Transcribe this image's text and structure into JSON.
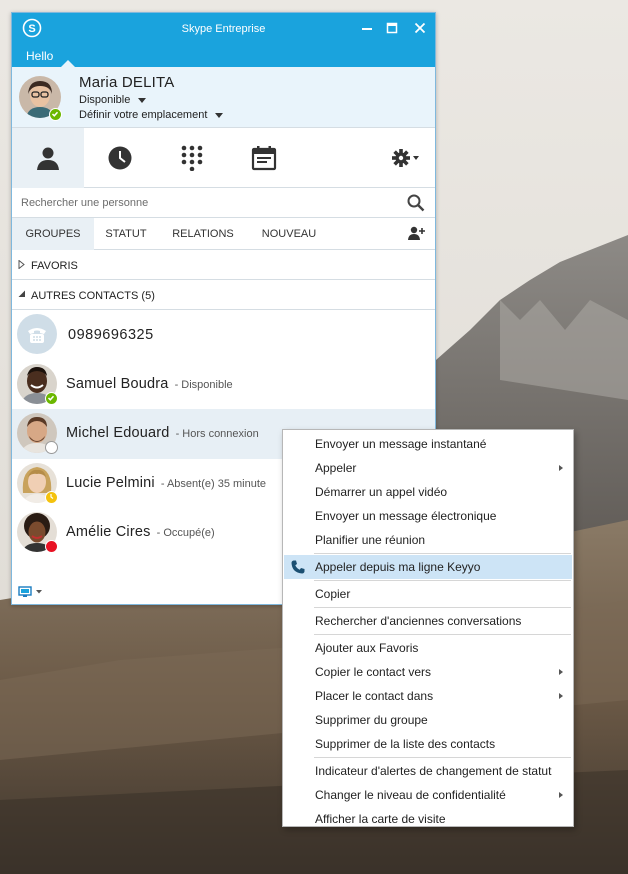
{
  "window": {
    "title": "Skype Entreprise",
    "hello": "Hello",
    "controls": {
      "minimize": "—",
      "maximize": "☐",
      "close": "✕"
    }
  },
  "profile": {
    "name": "Maria DELITA",
    "status": "Disponible",
    "location": "Définir votre emplacement",
    "presence_color": "#6bb700"
  },
  "main_tabs": [
    {
      "icon": "person-icon"
    },
    {
      "icon": "clock-icon"
    },
    {
      "icon": "dialpad-icon"
    },
    {
      "icon": "calendar-icon"
    },
    {
      "icon": "gear-icon"
    }
  ],
  "search": {
    "placeholder": "Rechercher une personne",
    "value": ""
  },
  "view_tabs": [
    "GROUPES",
    "STATUT",
    "RELATIONS",
    "NOUVEAU"
  ],
  "groups": {
    "favoris": "FAVORIS",
    "autres": "AUTRES CONTACTS (5)"
  },
  "contacts": [
    {
      "name": "0989696325",
      "status": "",
      "presence": "none"
    },
    {
      "name": "Samuel Boudra",
      "status": "- Disponible",
      "presence": "available"
    },
    {
      "name": "Michel Edouard",
      "status": "- Hors connexion",
      "presence": "offline"
    },
    {
      "name": "Lucie Pelmini",
      "status": "- Absent(e) 35 minute",
      "presence": "away"
    },
    {
      "name": "Amélie Cires",
      "status": "- Occupé(e)",
      "presence": "busy"
    }
  ],
  "context_menu": {
    "items": [
      {
        "label": "Envoyer un message instantané"
      },
      {
        "label": "Appeler",
        "submenu": true
      },
      {
        "label": "Démarrer un appel vidéo"
      },
      {
        "label": "Envoyer un message électronique"
      },
      {
        "label": "Planifier une réunion"
      },
      {
        "label": "Appeler depuis ma ligne Keyyo",
        "icon": "phone-icon",
        "highlighted": true
      },
      {
        "label": "Copier"
      },
      {
        "label": "Rechercher d'anciennes conversations"
      },
      {
        "label": "Ajouter aux Favoris"
      },
      {
        "label": "Copier le contact vers",
        "submenu": true
      },
      {
        "label": "Placer le contact dans",
        "submenu": true
      },
      {
        "label": "Supprimer du groupe"
      },
      {
        "label": "Supprimer de la liste des contacts"
      },
      {
        "label": "Indicateur d'alertes de changement de statut"
      },
      {
        "label": "Changer le niveau de confidentialité",
        "submenu": true
      },
      {
        "label": "Afficher la carte de visite"
      }
    ]
  },
  "colors": {
    "accent": "#1aa3dd",
    "highlight": "#cde4f6",
    "available": "#6bb700",
    "away": "#f4c20d",
    "busy": "#e81123"
  }
}
